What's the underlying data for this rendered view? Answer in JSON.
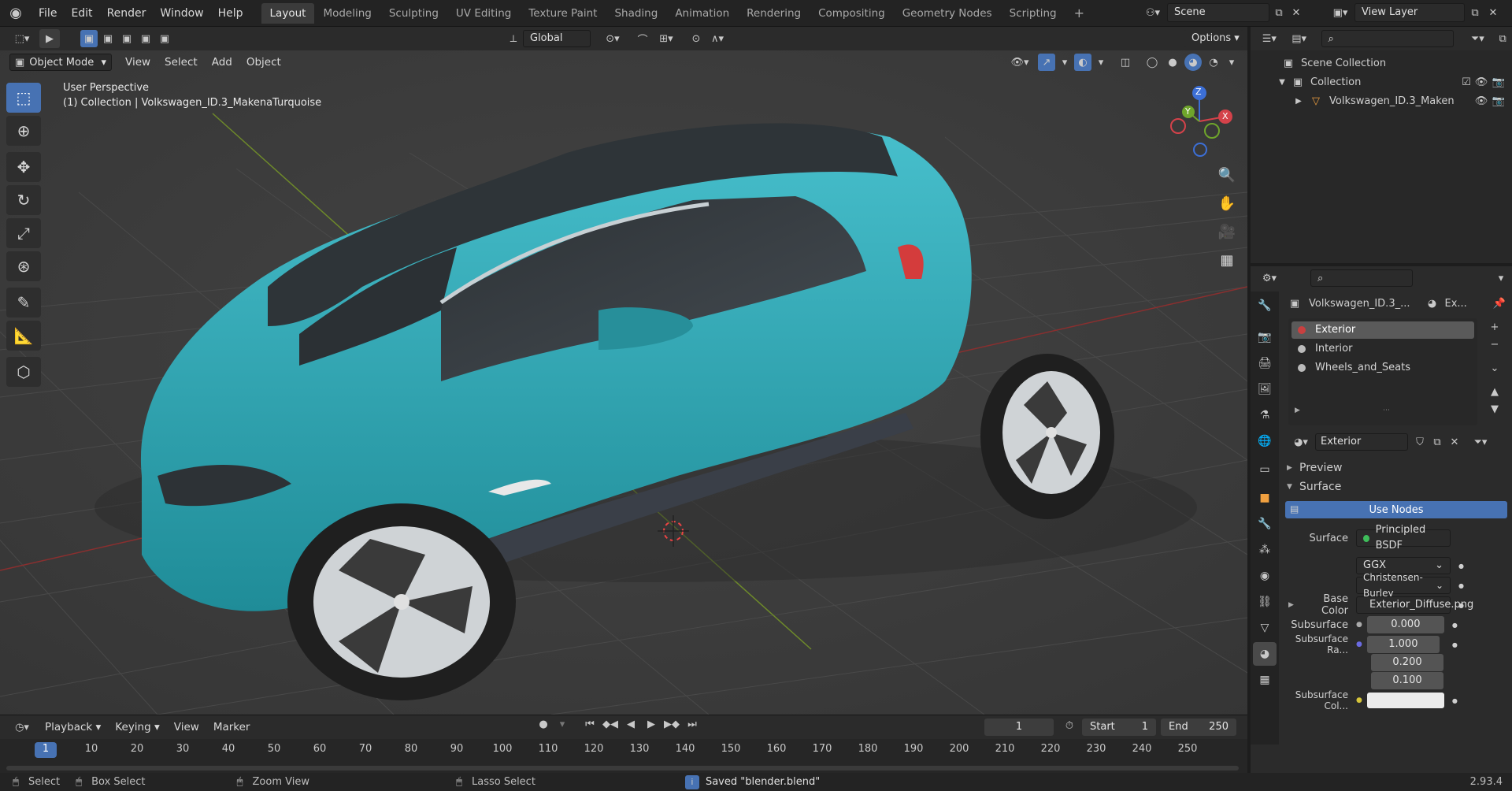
{
  "topbar": {
    "menus": [
      "File",
      "Edit",
      "Render",
      "Window",
      "Help"
    ],
    "workspaces": [
      "Layout",
      "Modeling",
      "Sculpting",
      "UV Editing",
      "Texture Paint",
      "Shading",
      "Animation",
      "Rendering",
      "Compositing",
      "Geometry Nodes",
      "Scripting"
    ],
    "active_workspace": "Layout",
    "scene": "Scene",
    "view_layer": "View Layer"
  },
  "viewport": {
    "orientation": "Global",
    "options": "Options",
    "mode": "Object Mode",
    "menus": [
      "View",
      "Select",
      "Add",
      "Object"
    ],
    "overlay_title": "User Perspective",
    "overlay_subtitle": "(1) Collection | Volkswagen_ID.3_MakenaTurquoise",
    "gizmo": {
      "z": "Z",
      "y": "Y",
      "x": "X"
    }
  },
  "outliner": {
    "root": "Scene Collection",
    "collection": "Collection",
    "object": "Volkswagen_ID.3_Maken"
  },
  "properties": {
    "object_name": "Volkswagen_ID.3_...",
    "material_short": "Ex...",
    "slots": [
      "Exterior",
      "Interior",
      "Wheels_and_Seats"
    ],
    "active_slot": "Exterior",
    "material_name": "Exterior",
    "sections": {
      "preview": "Preview",
      "surface": "Surface"
    },
    "use_nodes": "Use Nodes",
    "rows": {
      "surface_label": "Surface",
      "surface_value": "Principled BSDF",
      "distribution": "GGX",
      "subsurface_method": "Christensen-Burley",
      "base_color_label": "Base Color",
      "base_color_value": "Exterior_Diffuse.png",
      "subsurface_label": "Subsurface",
      "subsurface_value": "0.000",
      "subsurface_radius_label": "Subsurface Ra...",
      "radius": [
        "1.000",
        "0.200",
        "0.100"
      ],
      "subsurface_color_label": "Subsurface Col..."
    }
  },
  "timeline": {
    "menus": [
      "Playback",
      "Keying",
      "View",
      "Marker"
    ],
    "current_frame": "1",
    "start_label": "Start",
    "start": "1",
    "end_label": "End",
    "end": "250",
    "ticks": [
      "1",
      "10",
      "20",
      "30",
      "40",
      "50",
      "60",
      "70",
      "80",
      "90",
      "100",
      "110",
      "120",
      "130",
      "140",
      "150",
      "160",
      "170",
      "180",
      "190",
      "200",
      "210",
      "220",
      "230",
      "240",
      "250"
    ]
  },
  "statusbar": {
    "select": "Select",
    "box_select": "Box Select",
    "zoom_view": "Zoom View",
    "lasso_select": "Lasso Select",
    "message": "Saved \"blender.blend\"",
    "version": "2.93.4"
  },
  "colors": {
    "accent": "#4772b3",
    "car_body": "#2fa4b3",
    "car_roof": "#2e3438",
    "grid_x": "#8a2f2f",
    "grid_y": "#6e8a2a"
  }
}
